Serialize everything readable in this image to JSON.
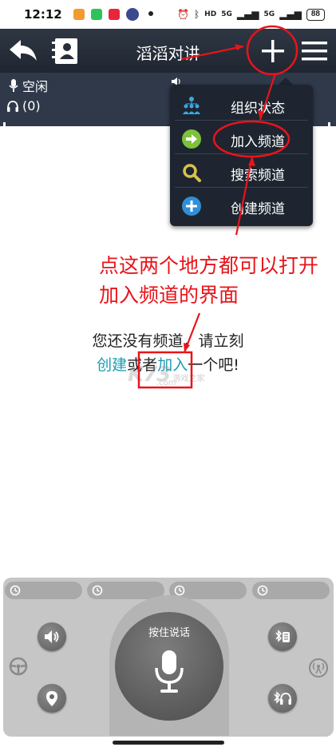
{
  "status_bar": {
    "time": "12:12",
    "dot": "•",
    "wifi_label": "HD",
    "net1": "5G",
    "net2": "5G",
    "battery": "88",
    "icons": [
      "alarm-icon",
      "bluetooth-icon",
      "vibrate-icon",
      "signal-icon"
    ]
  },
  "header": {
    "title": "滔滔对讲",
    "back_icon": "back-arrow-icon",
    "contacts_icon": "contacts-book-icon",
    "add_icon": "plus-icon",
    "menu_icon": "hamburger-menu-icon"
  },
  "status_strip": {
    "mic_state": "空闲",
    "listener_count": "(0)"
  },
  "dropdown_menu": {
    "items": [
      {
        "label": "组织状态",
        "icon": "organization-icon"
      },
      {
        "label": "加入频道",
        "icon": "join-arrow-icon"
      },
      {
        "label": "搜索频道",
        "icon": "search-icon"
      },
      {
        "label": "创建频道",
        "icon": "add-circle-icon"
      }
    ]
  },
  "empty_state": {
    "line1": "您还没有频道，请立刻",
    "create_link": "创建",
    "middle": "或者",
    "join_link": "加入",
    "tail": "一个吧!"
  },
  "annotation": {
    "line1": "点这两个地方都可以打开",
    "line2": "加入频道的界面",
    "color": "#e8141a"
  },
  "watermark": {
    "logo": "K73",
    "text": "游戏之家",
    "domain": ".com"
  },
  "control_panel": {
    "talk_label": "按住说话",
    "chips": [
      "history-icon",
      "history-icon",
      "history-icon",
      "history-icon"
    ],
    "left_buttons": [
      "speaker-icon",
      "location-icon"
    ],
    "right_buttons": [
      "bluetooth-ptt-icon",
      "bluetooth-headset-icon"
    ]
  },
  "colors": {
    "title_bar": "#262e3a",
    "strip": "#2f3949",
    "link": "#1a9bb4",
    "panel": "#c6c6c6"
  }
}
